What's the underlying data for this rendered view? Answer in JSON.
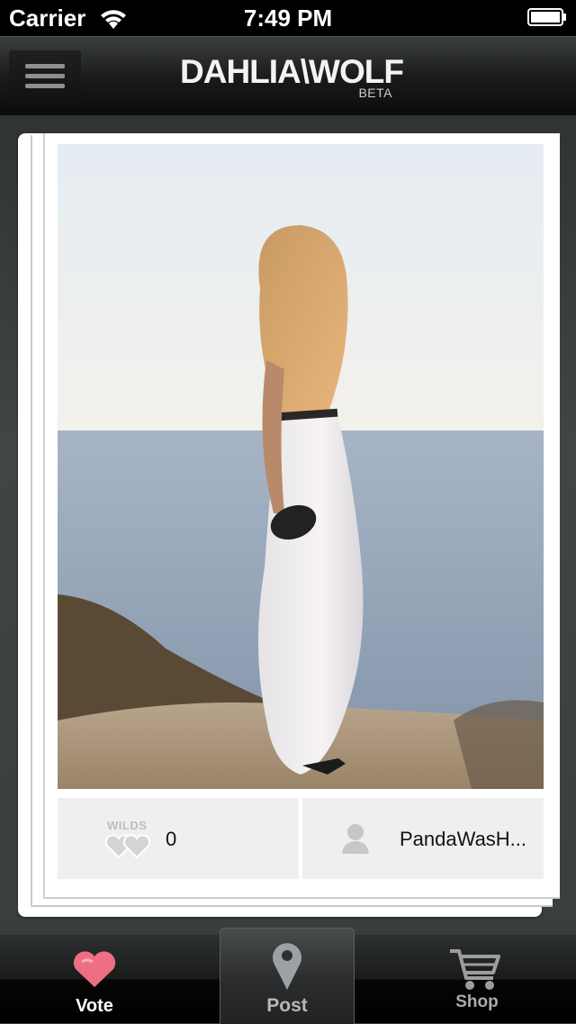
{
  "status_bar": {
    "carrier": "Carrier",
    "time": "7:49 PM"
  },
  "nav": {
    "logo_text": "DAHLIA\\WOLF",
    "logo_badge": "BETA",
    "menu_icon": "hamburger-icon"
  },
  "card": {
    "wilds_label": "WILDS",
    "wilds_count": "0",
    "username": "PandaWasH..."
  },
  "tabs": [
    {
      "label": "Vote",
      "icon": "heart-icon",
      "active": true
    },
    {
      "label": "Post",
      "icon": "location-pin-icon",
      "active": false
    },
    {
      "label": "Shop",
      "icon": "cart-icon",
      "active": false
    }
  ],
  "colors": {
    "accent_heart": "#ee6f84",
    "nav_bg": "#1a1b1c",
    "content_bg": "#3f4443"
  }
}
